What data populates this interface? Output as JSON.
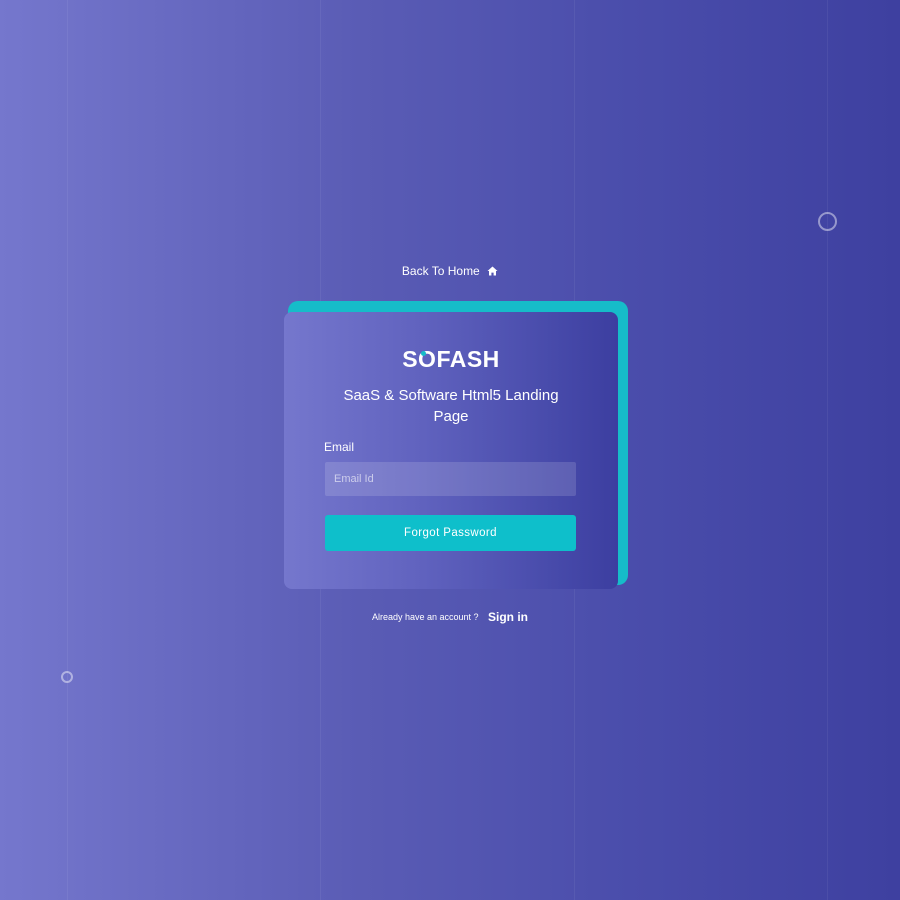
{
  "nav": {
    "back_home_label": "Back To Home",
    "home_icon": "home-icon"
  },
  "card": {
    "brand": {
      "part1": "S",
      "part2": "O",
      "part3": "FASH"
    },
    "subtitle": "SaaS & Software Html5 Landing Page",
    "email_label": "Email",
    "email_placeholder": "Email Id",
    "email_value": "",
    "submit_label": "Forgot Password"
  },
  "footer": {
    "prompt": "Already have an account ?",
    "sign_in_label": "Sign in"
  },
  "colors": {
    "accent": "#0ebfcb",
    "background_start": "#7577cd",
    "background_end": "#3e40a0",
    "text": "#ffffff"
  }
}
